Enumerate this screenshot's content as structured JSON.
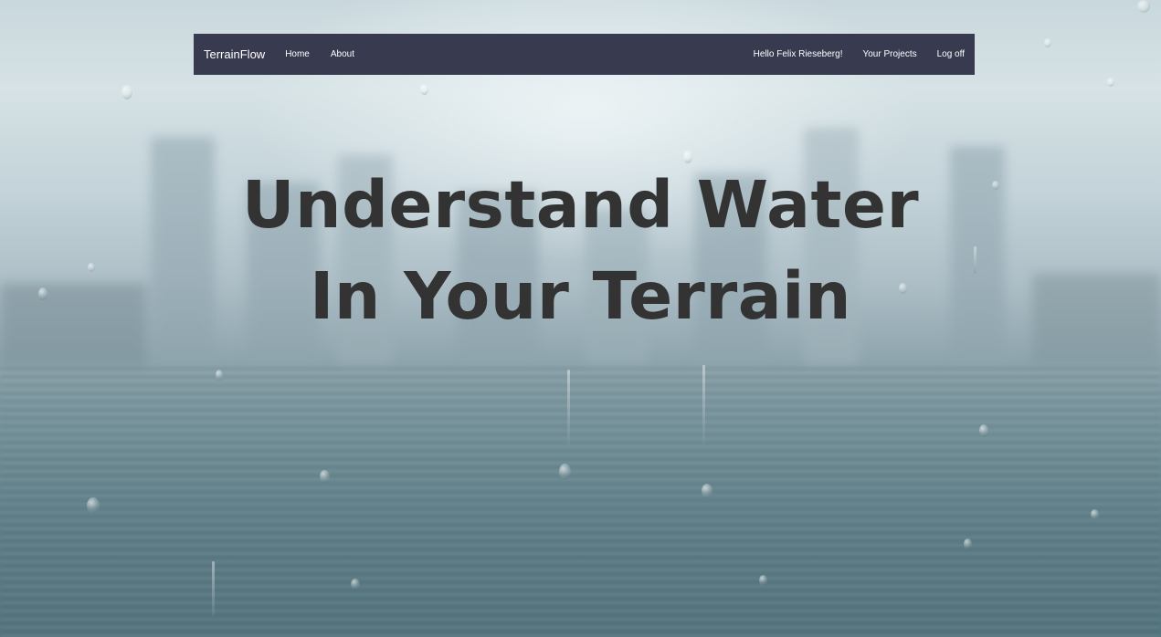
{
  "navbar": {
    "brand": "TerrainFlow",
    "left_links": [
      "Home",
      "About"
    ],
    "greeting": "Hello Felix Rieseberg!",
    "projects_label": "Your Projects",
    "logoff_label": "Log off",
    "background_color": "#383b50"
  },
  "hero": {
    "headline_line1": "Understand Water",
    "headline_line2": "In Your Terrain",
    "headline_color": "#333333",
    "background_image": "rainy-window-city-skyline"
  }
}
